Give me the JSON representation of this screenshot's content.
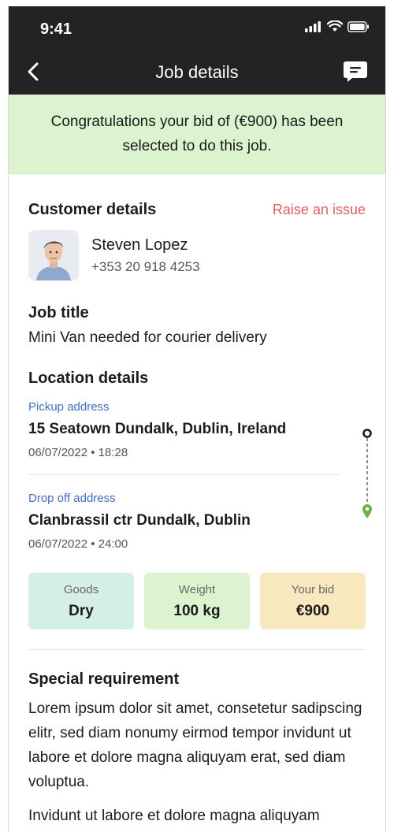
{
  "status_bar": {
    "time": "9:41"
  },
  "header": {
    "title": "Job details"
  },
  "banner": {
    "text": "Congratulations your bid of (€900) has been selected to do this job."
  },
  "customer": {
    "heading": "Customer details",
    "raise_issue": "Raise an issue",
    "name": "Steven Lopez",
    "phone": "+353 20 918 4253"
  },
  "job": {
    "heading": "Job title",
    "title": "Mini Van needed for courier delivery"
  },
  "location": {
    "heading": "Location details",
    "pickup": {
      "label": "Pickup address",
      "address": "15 Seatown Dundalk, Dublin, Ireland",
      "datetime": "06/07/2022 • 18:28"
    },
    "dropoff": {
      "label": "Drop off address",
      "address": "Clanbrassil ctr Dundalk, Dublin",
      "datetime": "06/07/2022 • 24:00"
    }
  },
  "stats": [
    {
      "label": "Goods",
      "value": "Dry",
      "color": "#d5efe8"
    },
    {
      "label": "Weight",
      "value": "100 kg",
      "color": "#dcf3d0"
    },
    {
      "label": "Your bid",
      "value": "€900",
      "color": "#f8e8bd"
    }
  ],
  "requirement": {
    "heading": "Special requirement",
    "paragraph1": "Lorem ipsum dolor sit amet, consetetur sadipscing elitr, sed diam nonumy eirmod tempor invidunt ut labore et dolore magna aliquyam erat, sed diam voluptua.",
    "paragraph2": "Invidunt ut labore et dolore magna aliquyam"
  },
  "colors": {
    "header_bg": "#232323",
    "banner_bg": "#dcf3d0",
    "link_red": "#e0605c",
    "label_blue": "#3f6fbf",
    "pin_green": "#6bb04a"
  },
  "icons": [
    "back-icon",
    "chat-icon",
    "signal-icon",
    "wifi-icon",
    "battery-icon",
    "avatar",
    "route-start-icon",
    "route-end-pin-icon"
  ]
}
